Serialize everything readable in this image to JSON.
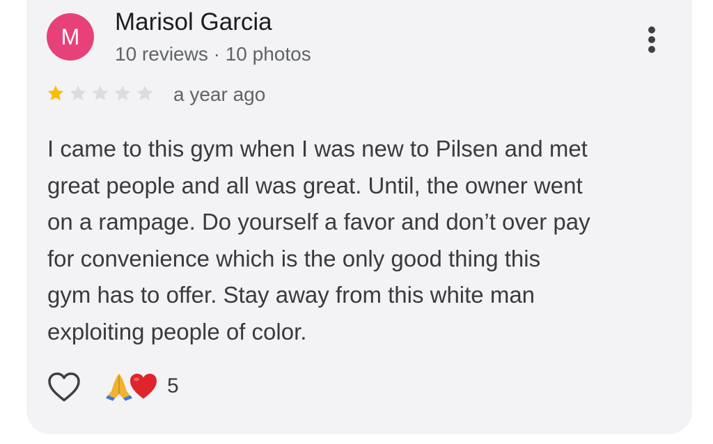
{
  "review": {
    "author_initial": "M",
    "author_name": "Marisol Garcia",
    "author_meta": "10 reviews · 10 photos",
    "rating": 1,
    "rating_max": 5,
    "time_ago": "a year ago",
    "text_lines": [
      "I came to this gym when I was new to Pilsen and met",
      "great people and all was great. Until, the owner went",
      "on a rampage. Do yourself a favor and don’t over pay",
      "for convenience which is the only good thing this",
      "gym has to offer. Stay away from this white man",
      "exploiting people of color."
    ],
    "reactions_count": "5",
    "reaction_icons": [
      "folded-hands-emoji",
      "red-heart-emoji"
    ]
  },
  "colors": {
    "avatar_bg": "#e8417a",
    "star_filled": "#fbbc04",
    "star_empty": "#dadce0",
    "card_bg": "#f3f3f6"
  },
  "icons": {
    "more": "more-vertical-icon",
    "like": "heart-outline-icon"
  }
}
